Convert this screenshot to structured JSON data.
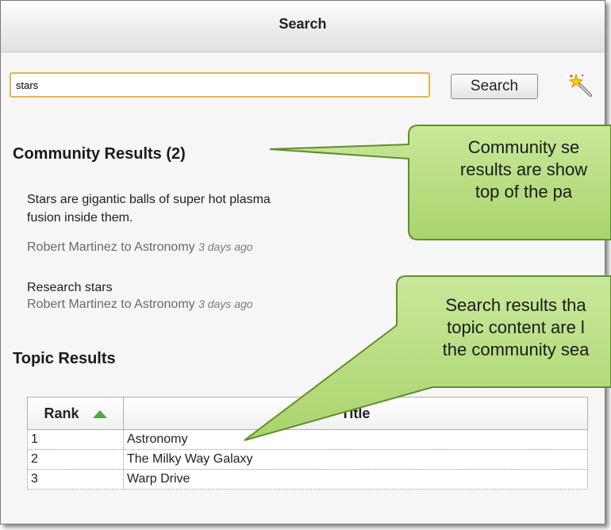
{
  "window": {
    "title": "Search"
  },
  "search": {
    "value": "stars",
    "button_label": "Search",
    "wizard_icon": "magic-wand-icon"
  },
  "community": {
    "heading": "Community Results (2)",
    "results": [
      {
        "text": "Stars are gigantic balls of super hot plasma",
        "text2": "fusion inside them.",
        "author": "Robert Martinez to Astronomy",
        "time": "3 days ago"
      },
      {
        "text": "Research stars",
        "author": "Robert Martinez to Astronomy",
        "time": "3 days ago"
      }
    ]
  },
  "topics": {
    "heading": "Topic Results",
    "columns": [
      "Rank",
      "Title"
    ],
    "sort_icon": "sort-ascending-icon",
    "rows": [
      {
        "rank": "1",
        "title": "Astronomy"
      },
      {
        "rank": "2",
        "title": "The Milky Way Galaxy"
      },
      {
        "rank": "3",
        "title": "Warp Drive"
      }
    ]
  },
  "callouts": [
    {
      "lines": [
        "Community se",
        "results are show",
        "top of the pa"
      ]
    },
    {
      "lines": [
        "Search results tha",
        "topic content are l",
        "the community sea"
      ]
    }
  ],
  "colors": {
    "callout_fill": "#b7dd7e",
    "callout_border": "#5f8f2c",
    "input_border": "#e0b458",
    "sort_arrow": "#4daa3d"
  }
}
